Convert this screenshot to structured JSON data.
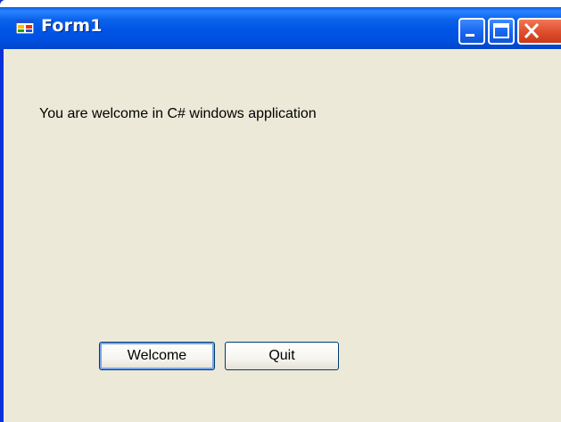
{
  "window": {
    "title": "Form1",
    "title_bar_color": "#0055e6",
    "icons": {
      "app": "form-app-icon",
      "minimize": "minimize-icon",
      "maximize": "maximize-icon",
      "close": "close-icon"
    }
  },
  "form": {
    "label_text": "You are welcome in C# windows application",
    "welcome_button_label": "Welcome",
    "quit_button_label": "Quit",
    "background_color": "#ece9d8"
  }
}
